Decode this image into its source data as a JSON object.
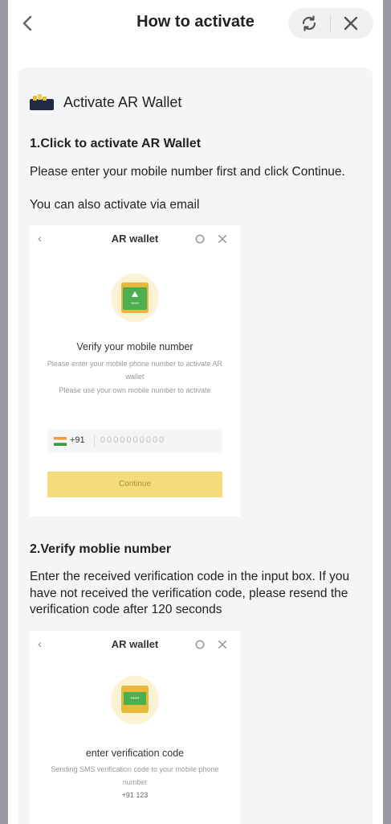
{
  "header": {
    "title": "How to activate"
  },
  "card": {
    "title": "Activate AR Wallet",
    "step1": {
      "heading": "1.Click to activate AR Wallet",
      "line1": "Please enter your mobile number first and click Continue.",
      "line2": "You can also activate via email"
    },
    "step2": {
      "heading": "2.Verify moblie number",
      "text": "Enter the received verification code in the input box. If you have not received the verification code, please resend the verification code after 120 seconds"
    }
  },
  "shot1": {
    "title": "AR wallet",
    "heading": "Verify your mobile number",
    "sub1": "Please enter your mobile phone number to activate AR wallet",
    "sub2": "Please use your own mobile number to activate",
    "country_code": "+91",
    "phone_placeholder": "0000000000",
    "continue_label": "Continue"
  },
  "shot2": {
    "title": "AR wallet",
    "heading": "enter verification code",
    "sub": "Sending SMS verification code to your mobile phone number",
    "number": "+91 123"
  },
  "colors": {
    "accent_yellow": "#f4dc7a",
    "emblem_green": "#4caf50"
  },
  "icons": [
    "chevron-left-icon",
    "refresh-icon",
    "close-icon",
    "wallet-icon",
    "flag-icon"
  ]
}
